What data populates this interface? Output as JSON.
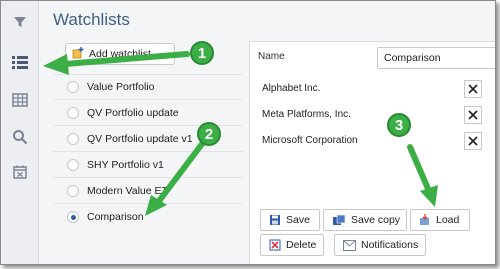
{
  "title": "Watchlists",
  "iconbar": {
    "icons": [
      "filter-icon",
      "list-icon",
      "table-icon",
      "search-icon",
      "calendar-icon"
    ]
  },
  "left": {
    "add_label": "Add watchlist",
    "items": [
      {
        "label": "Value Portfolio",
        "selected": false
      },
      {
        "label": "QV Portfolio update",
        "selected": false
      },
      {
        "label": "QV Portfolio update v1",
        "selected": false
      },
      {
        "label": "SHY Portfolio v1",
        "selected": false
      },
      {
        "label": "Modern Value ET",
        "selected": false
      },
      {
        "label": "Comparison",
        "selected": true
      }
    ]
  },
  "right": {
    "name_label": "Name",
    "name_value": "Comparison",
    "tickers": [
      "Alphabet Inc.",
      "Meta Platforms, Inc.",
      "Microsoft Corporation"
    ],
    "buttons": {
      "save": "Save",
      "save_copy": "Save copy",
      "load": "Load",
      "delete": "Delete",
      "notifications": "Notifications"
    }
  },
  "callouts": [
    "1",
    "2",
    "3"
  ],
  "colors": {
    "accent": "#3f5f86",
    "callout_green": "#3cae46",
    "radio_selected": "#2e5aa8"
  }
}
